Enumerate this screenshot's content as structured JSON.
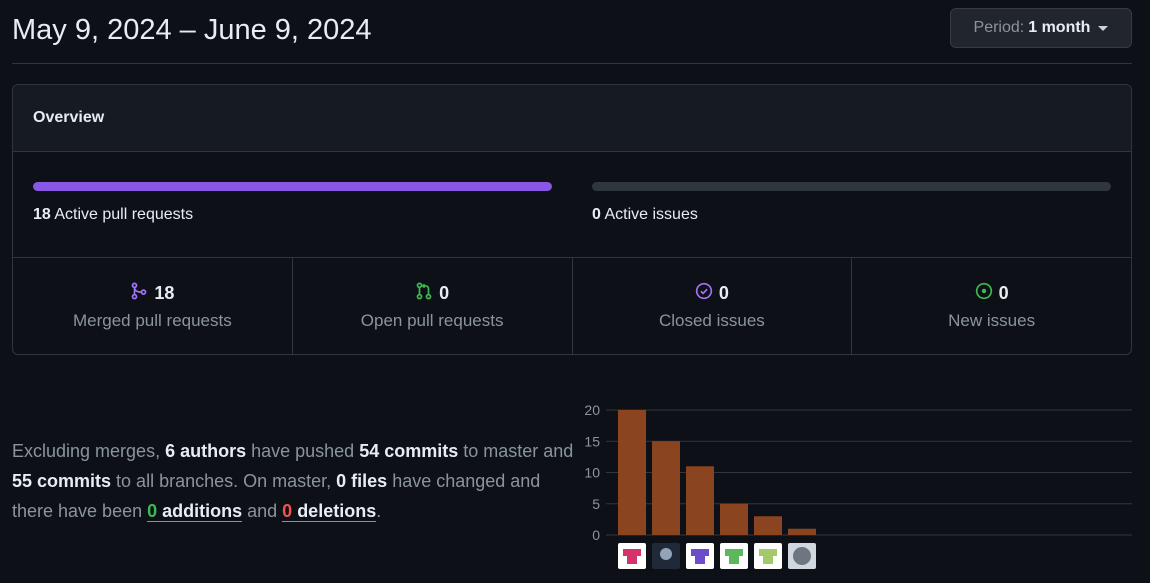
{
  "header": {
    "date_range": "May 9, 2024 – June 9, 2024",
    "period_label": "Period:",
    "period_value": "1 month"
  },
  "overview": {
    "title": "Overview",
    "active_prs": {
      "count": "18",
      "label": "Active pull requests",
      "fill_fraction": 1.0,
      "color": "#8957e5"
    },
    "active_issues": {
      "count": "0",
      "label": "Active issues",
      "fill_fraction": 0.0
    },
    "stats": [
      {
        "count": "18",
        "label": "Merged pull requests",
        "icon": "git-merge-icon",
        "color": "#a371f7"
      },
      {
        "count": "0",
        "label": "Open pull requests",
        "icon": "git-pull-request-icon",
        "color": "#3fb950"
      },
      {
        "count": "0",
        "label": "Closed issues",
        "icon": "issue-closed-icon",
        "color": "#a371f7"
      },
      {
        "count": "0",
        "label": "New issues",
        "icon": "issue-opened-icon",
        "color": "#3fb950"
      }
    ]
  },
  "summary": {
    "t1": "Excluding merges, ",
    "authors": "6 authors",
    "t2": " have pushed ",
    "commits_master": "54 commits",
    "t3": " to master and ",
    "commits_all": "55 commits",
    "t4": " to all branches. On master, ",
    "files": "0 files",
    "t5": " have changed and there have been ",
    "additions_num": "0",
    "additions_word": " additions",
    "t6": " and ",
    "deletions_num": "0",
    "deletions_word": " deletions",
    "t7": "."
  },
  "chart_data": {
    "type": "bar",
    "categories": [
      "author-1",
      "author-2",
      "author-3",
      "author-4",
      "author-5",
      "author-6"
    ],
    "values": [
      20,
      15,
      11,
      5,
      3,
      1
    ],
    "ylim": [
      0,
      20
    ],
    "yticks": [
      0,
      5,
      10,
      15,
      20
    ],
    "bar_color": "#8a4420",
    "grid": true,
    "avatar_icons": [
      "avatar-pink-identicon",
      "avatar-photo",
      "avatar-purple-identicon",
      "avatar-green-identicon",
      "avatar-lightgreen-identicon",
      "avatar-github-icon"
    ]
  }
}
